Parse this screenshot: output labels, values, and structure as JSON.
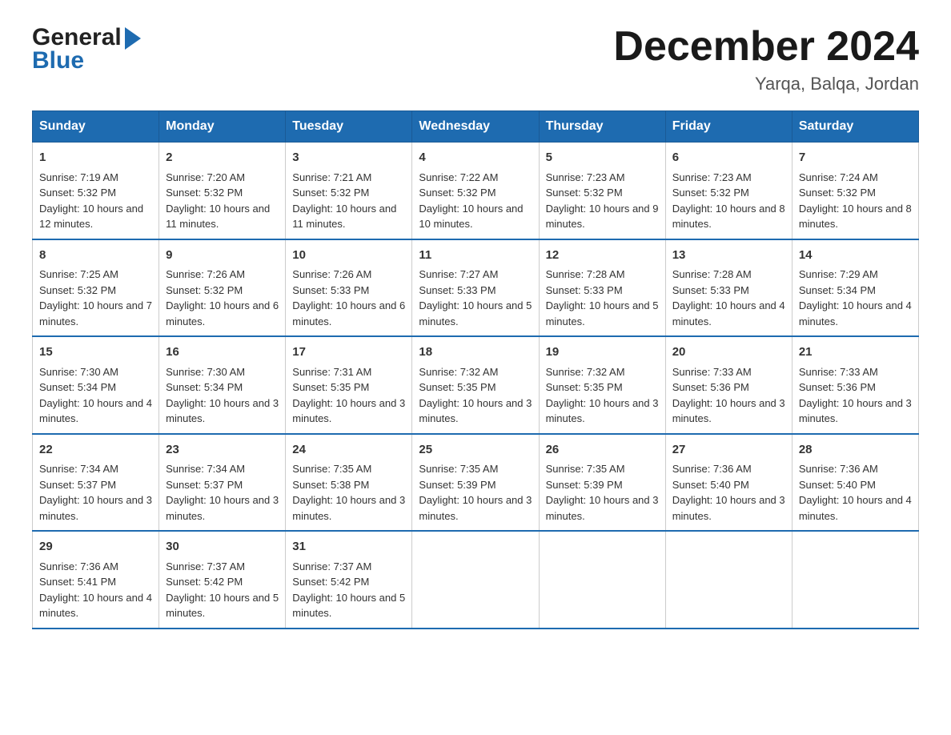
{
  "header": {
    "logo_general": "General",
    "logo_blue": "Blue",
    "title": "December 2024",
    "subtitle": "Yarqa, Balqa, Jordan"
  },
  "columns": [
    "Sunday",
    "Monday",
    "Tuesday",
    "Wednesday",
    "Thursday",
    "Friday",
    "Saturday"
  ],
  "weeks": [
    [
      {
        "day": "1",
        "sunrise": "7:19 AM",
        "sunset": "5:32 PM",
        "daylight": "10 hours and 12 minutes."
      },
      {
        "day": "2",
        "sunrise": "7:20 AM",
        "sunset": "5:32 PM",
        "daylight": "10 hours and 11 minutes."
      },
      {
        "day": "3",
        "sunrise": "7:21 AM",
        "sunset": "5:32 PM",
        "daylight": "10 hours and 11 minutes."
      },
      {
        "day": "4",
        "sunrise": "7:22 AM",
        "sunset": "5:32 PM",
        "daylight": "10 hours and 10 minutes."
      },
      {
        "day": "5",
        "sunrise": "7:23 AM",
        "sunset": "5:32 PM",
        "daylight": "10 hours and 9 minutes."
      },
      {
        "day": "6",
        "sunrise": "7:23 AM",
        "sunset": "5:32 PM",
        "daylight": "10 hours and 8 minutes."
      },
      {
        "day": "7",
        "sunrise": "7:24 AM",
        "sunset": "5:32 PM",
        "daylight": "10 hours and 8 minutes."
      }
    ],
    [
      {
        "day": "8",
        "sunrise": "7:25 AM",
        "sunset": "5:32 PM",
        "daylight": "10 hours and 7 minutes."
      },
      {
        "day": "9",
        "sunrise": "7:26 AM",
        "sunset": "5:32 PM",
        "daylight": "10 hours and 6 minutes."
      },
      {
        "day": "10",
        "sunrise": "7:26 AM",
        "sunset": "5:33 PM",
        "daylight": "10 hours and 6 minutes."
      },
      {
        "day": "11",
        "sunrise": "7:27 AM",
        "sunset": "5:33 PM",
        "daylight": "10 hours and 5 minutes."
      },
      {
        "day": "12",
        "sunrise": "7:28 AM",
        "sunset": "5:33 PM",
        "daylight": "10 hours and 5 minutes."
      },
      {
        "day": "13",
        "sunrise": "7:28 AM",
        "sunset": "5:33 PM",
        "daylight": "10 hours and 4 minutes."
      },
      {
        "day": "14",
        "sunrise": "7:29 AM",
        "sunset": "5:34 PM",
        "daylight": "10 hours and 4 minutes."
      }
    ],
    [
      {
        "day": "15",
        "sunrise": "7:30 AM",
        "sunset": "5:34 PM",
        "daylight": "10 hours and 4 minutes."
      },
      {
        "day": "16",
        "sunrise": "7:30 AM",
        "sunset": "5:34 PM",
        "daylight": "10 hours and 3 minutes."
      },
      {
        "day": "17",
        "sunrise": "7:31 AM",
        "sunset": "5:35 PM",
        "daylight": "10 hours and 3 minutes."
      },
      {
        "day": "18",
        "sunrise": "7:32 AM",
        "sunset": "5:35 PM",
        "daylight": "10 hours and 3 minutes."
      },
      {
        "day": "19",
        "sunrise": "7:32 AM",
        "sunset": "5:35 PM",
        "daylight": "10 hours and 3 minutes."
      },
      {
        "day": "20",
        "sunrise": "7:33 AM",
        "sunset": "5:36 PM",
        "daylight": "10 hours and 3 minutes."
      },
      {
        "day": "21",
        "sunrise": "7:33 AM",
        "sunset": "5:36 PM",
        "daylight": "10 hours and 3 minutes."
      }
    ],
    [
      {
        "day": "22",
        "sunrise": "7:34 AM",
        "sunset": "5:37 PM",
        "daylight": "10 hours and 3 minutes."
      },
      {
        "day": "23",
        "sunrise": "7:34 AM",
        "sunset": "5:37 PM",
        "daylight": "10 hours and 3 minutes."
      },
      {
        "day": "24",
        "sunrise": "7:35 AM",
        "sunset": "5:38 PM",
        "daylight": "10 hours and 3 minutes."
      },
      {
        "day": "25",
        "sunrise": "7:35 AM",
        "sunset": "5:39 PM",
        "daylight": "10 hours and 3 minutes."
      },
      {
        "day": "26",
        "sunrise": "7:35 AM",
        "sunset": "5:39 PM",
        "daylight": "10 hours and 3 minutes."
      },
      {
        "day": "27",
        "sunrise": "7:36 AM",
        "sunset": "5:40 PM",
        "daylight": "10 hours and 3 minutes."
      },
      {
        "day": "28",
        "sunrise": "7:36 AM",
        "sunset": "5:40 PM",
        "daylight": "10 hours and 4 minutes."
      }
    ],
    [
      {
        "day": "29",
        "sunrise": "7:36 AM",
        "sunset": "5:41 PM",
        "daylight": "10 hours and 4 minutes."
      },
      {
        "day": "30",
        "sunrise": "7:37 AM",
        "sunset": "5:42 PM",
        "daylight": "10 hours and 5 minutes."
      },
      {
        "day": "31",
        "sunrise": "7:37 AM",
        "sunset": "5:42 PM",
        "daylight": "10 hours and 5 minutes."
      },
      null,
      null,
      null,
      null
    ]
  ],
  "labels": {
    "sunrise": "Sunrise:",
    "sunset": "Sunset:",
    "daylight": "Daylight:"
  }
}
